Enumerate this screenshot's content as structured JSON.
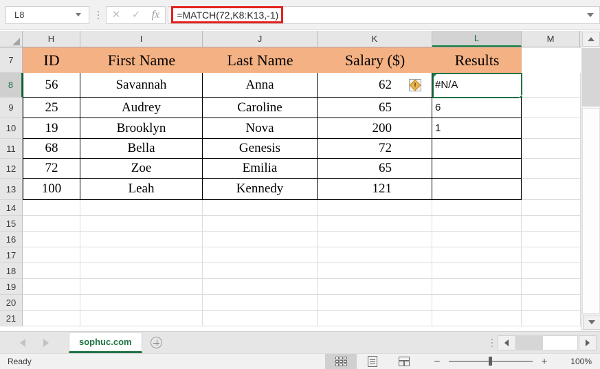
{
  "formula_bar": {
    "name_box_value": "L8",
    "cancel_icon": "x-icon",
    "enter_icon": "check-icon",
    "function_icon": "fx-icon",
    "formula": "=MATCH(72,K8:K13,-1)",
    "expand_icon": "chevron-down-icon",
    "highlight_color": "#e3211c"
  },
  "grid": {
    "column_headers": [
      "H",
      "I",
      "J",
      "K",
      "L",
      "M"
    ],
    "selected_column": "L",
    "row_headers": [
      "7",
      "8",
      "9",
      "10",
      "11",
      "12",
      "13",
      "14",
      "15",
      "16",
      "17",
      "18",
      "19",
      "20",
      "21"
    ],
    "selected_row": "8",
    "selected_cell": "L8",
    "header_fill": "#f4b183",
    "selection_color": "#217346",
    "table_headers": [
      "ID",
      "First Name",
      "Last Name",
      "Salary ($)",
      "Results"
    ],
    "rows": [
      {
        "row": "8",
        "id": "56",
        "first_name": "Savannah",
        "last_name": "Anna",
        "salary": "62",
        "result": "#N/A"
      },
      {
        "row": "9",
        "id": "25",
        "first_name": "Audrey",
        "last_name": "Caroline",
        "salary": "65",
        "result": "6"
      },
      {
        "row": "10",
        "id": "19",
        "first_name": "Brooklyn",
        "last_name": "Nova",
        "salary": "200",
        "result": "1"
      },
      {
        "row": "11",
        "id": "68",
        "first_name": "Bella",
        "last_name": "Genesis",
        "salary": "72",
        "result": ""
      },
      {
        "row": "12",
        "id": "72",
        "first_name": "Zoe",
        "last_name": "Emilia",
        "salary": "65",
        "result": ""
      },
      {
        "row": "13",
        "id": "100",
        "first_name": "Leah",
        "last_name": "Kennedy",
        "salary": "121",
        "result": ""
      }
    ],
    "warning_icon": "warning-exclamation-icon",
    "warning_cell": "K8",
    "error_indicator_icon": "green-triangle-error-icon"
  },
  "scrollbars": {
    "v_up_icon": "triangle-up-icon",
    "v_down_icon": "triangle-down-icon",
    "h_left_icon": "triangle-left-icon",
    "h_right_icon": "triangle-right-icon"
  },
  "sheet_tabs": {
    "prev_icon": "triangle-left-icon",
    "next_icon": "triangle-right-icon",
    "active_tab": "sophuc.com",
    "add_sheet_icon": "plus-circle-icon",
    "tab_accent": "#217346"
  },
  "status_bar": {
    "status": "Ready",
    "view_normal_icon": "normal-view-icon",
    "view_page_layout_icon": "page-layout-icon",
    "view_page_break_icon": "page-break-preview-icon",
    "zoom_out_label": "−",
    "zoom_in_label": "+",
    "zoom_level": "100%"
  }
}
